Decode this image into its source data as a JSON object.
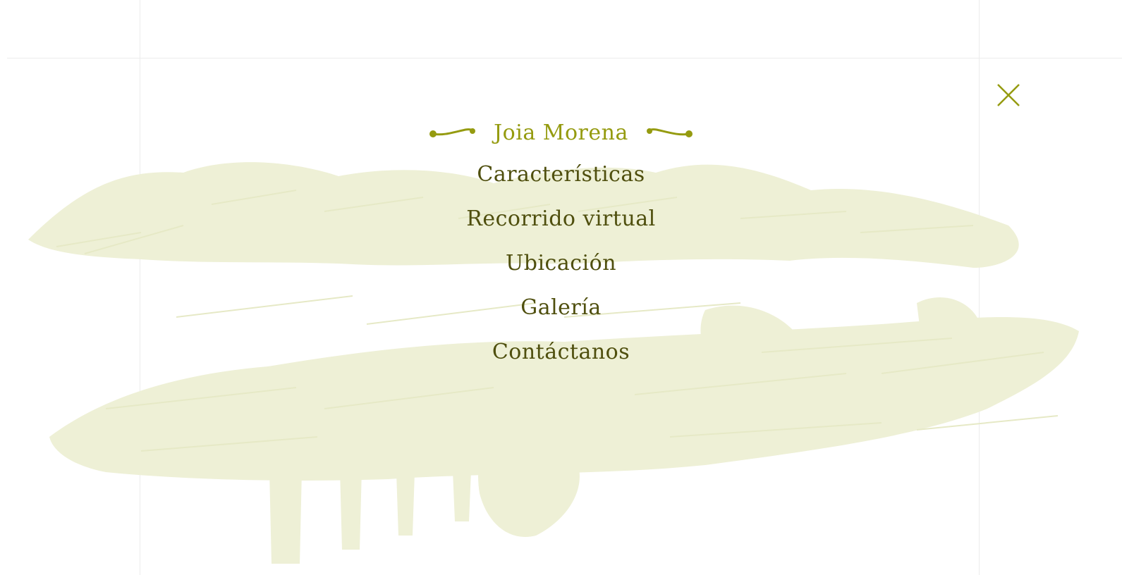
{
  "colors": {
    "accent": "#959b10",
    "menu_text": "#4f4f0e",
    "sketch": "#eef0d6",
    "guide_line": "#ececec",
    "background": "#ffffff"
  },
  "icons": {
    "close": "close-icon",
    "flourish_left": "flourish-left-icon",
    "flourish_right": "flourish-right-icon"
  },
  "menu": {
    "active": "Joia Morena",
    "items": [
      "Características",
      "Recorrido virtual",
      "Ubicación",
      "Galería",
      "Contáctanos"
    ]
  }
}
